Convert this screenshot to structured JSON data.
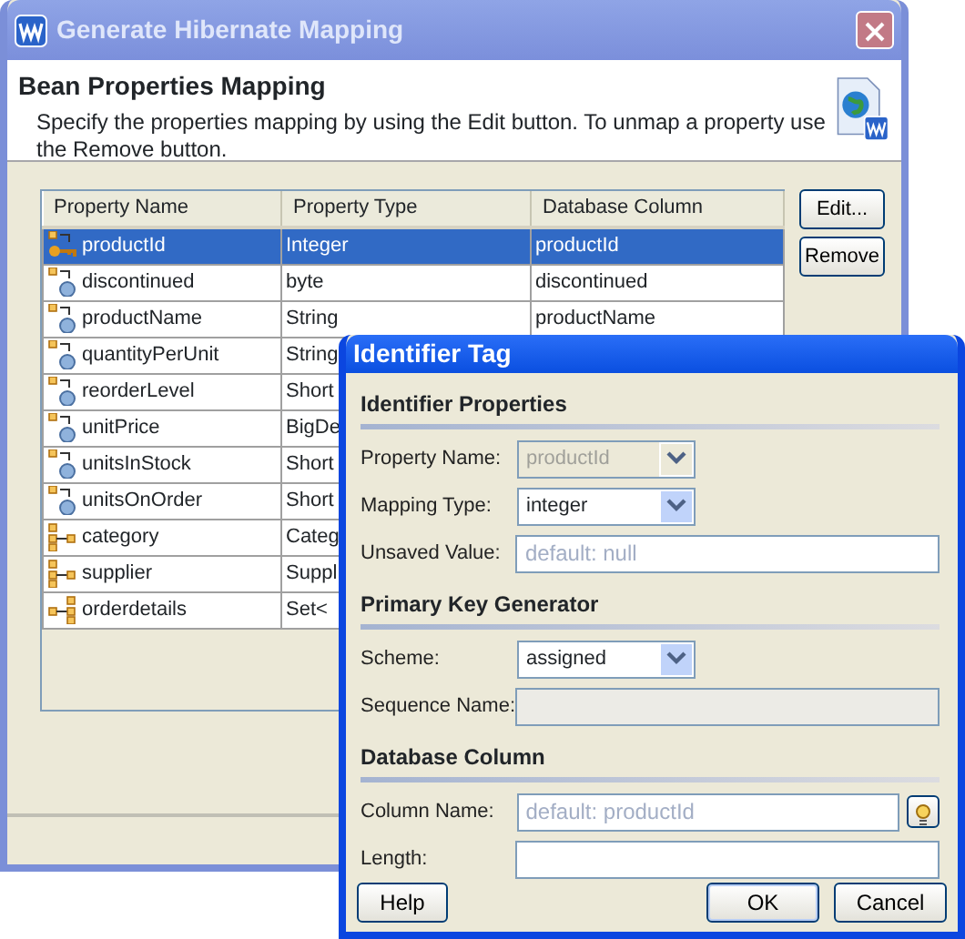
{
  "window": {
    "title": "Generate Hibernate Mapping",
    "heading": "Bean Properties Mapping",
    "description": "Specify the properties mapping by using the Edit button. To unmap a property use the Remove button."
  },
  "table": {
    "columns": [
      "Property Name",
      "Property Type",
      "Database Column"
    ],
    "rows": [
      {
        "kind": "key",
        "selected": true,
        "cells": [
          "productId",
          "Integer",
          "productId"
        ]
      },
      {
        "kind": "property",
        "selected": false,
        "cells": [
          "discontinued",
          "byte",
          "discontinued"
        ]
      },
      {
        "kind": "property",
        "selected": false,
        "cells": [
          "productName",
          "String",
          "productName"
        ]
      },
      {
        "kind": "property",
        "selected": false,
        "cells": [
          "quantityPerUnit",
          "String"
        ]
      },
      {
        "kind": "property",
        "selected": false,
        "cells": [
          "reorderLevel",
          "Short"
        ]
      },
      {
        "kind": "property",
        "selected": false,
        "cells": [
          "unitPrice",
          "BigDe"
        ]
      },
      {
        "kind": "property",
        "selected": false,
        "cells": [
          "unitsInStock",
          "Short"
        ]
      },
      {
        "kind": "property",
        "selected": false,
        "cells": [
          "unitsOnOrder",
          "Short"
        ]
      },
      {
        "kind": "many-to-one",
        "selected": false,
        "cells": [
          "category",
          "Categ"
        ]
      },
      {
        "kind": "many-to-one",
        "selected": false,
        "cells": [
          "supplier",
          "Suppl"
        ]
      },
      {
        "kind": "one-to-many",
        "selected": false,
        "cells": [
          "orderdetails",
          "Set<"
        ]
      }
    ]
  },
  "side_buttons": [
    "Edit...",
    "Remove"
  ],
  "dialog": {
    "title": "Identifier Tag",
    "sections": [
      {
        "title": "Identifier Properties",
        "fields": [
          {
            "kind": "combo",
            "label": "Property Name:",
            "value": "productId",
            "disabled": true
          },
          {
            "kind": "combo",
            "label": "Mapping Type:",
            "value": "integer",
            "disabled": false
          },
          {
            "kind": "text",
            "label": "Unsaved Value:",
            "placeholder": "default: null",
            "disabled": false
          }
        ]
      },
      {
        "title": "Primary Key Generator",
        "fields": [
          {
            "kind": "combo",
            "label": "Scheme:",
            "value": "assigned",
            "disabled": false
          },
          {
            "kind": "text",
            "label": "Sequence Name:",
            "disabled": true
          }
        ]
      },
      {
        "title": "Database Column",
        "fields": [
          {
            "kind": "text-hint",
            "label": "Column Name:",
            "placeholder": "default: productId",
            "disabled": false
          },
          {
            "kind": "text",
            "label": "Length:",
            "disabled": false
          }
        ]
      }
    ],
    "buttons": {
      "left": [
        "Help"
      ],
      "right": [
        "OK",
        "Cancel"
      ]
    }
  }
}
